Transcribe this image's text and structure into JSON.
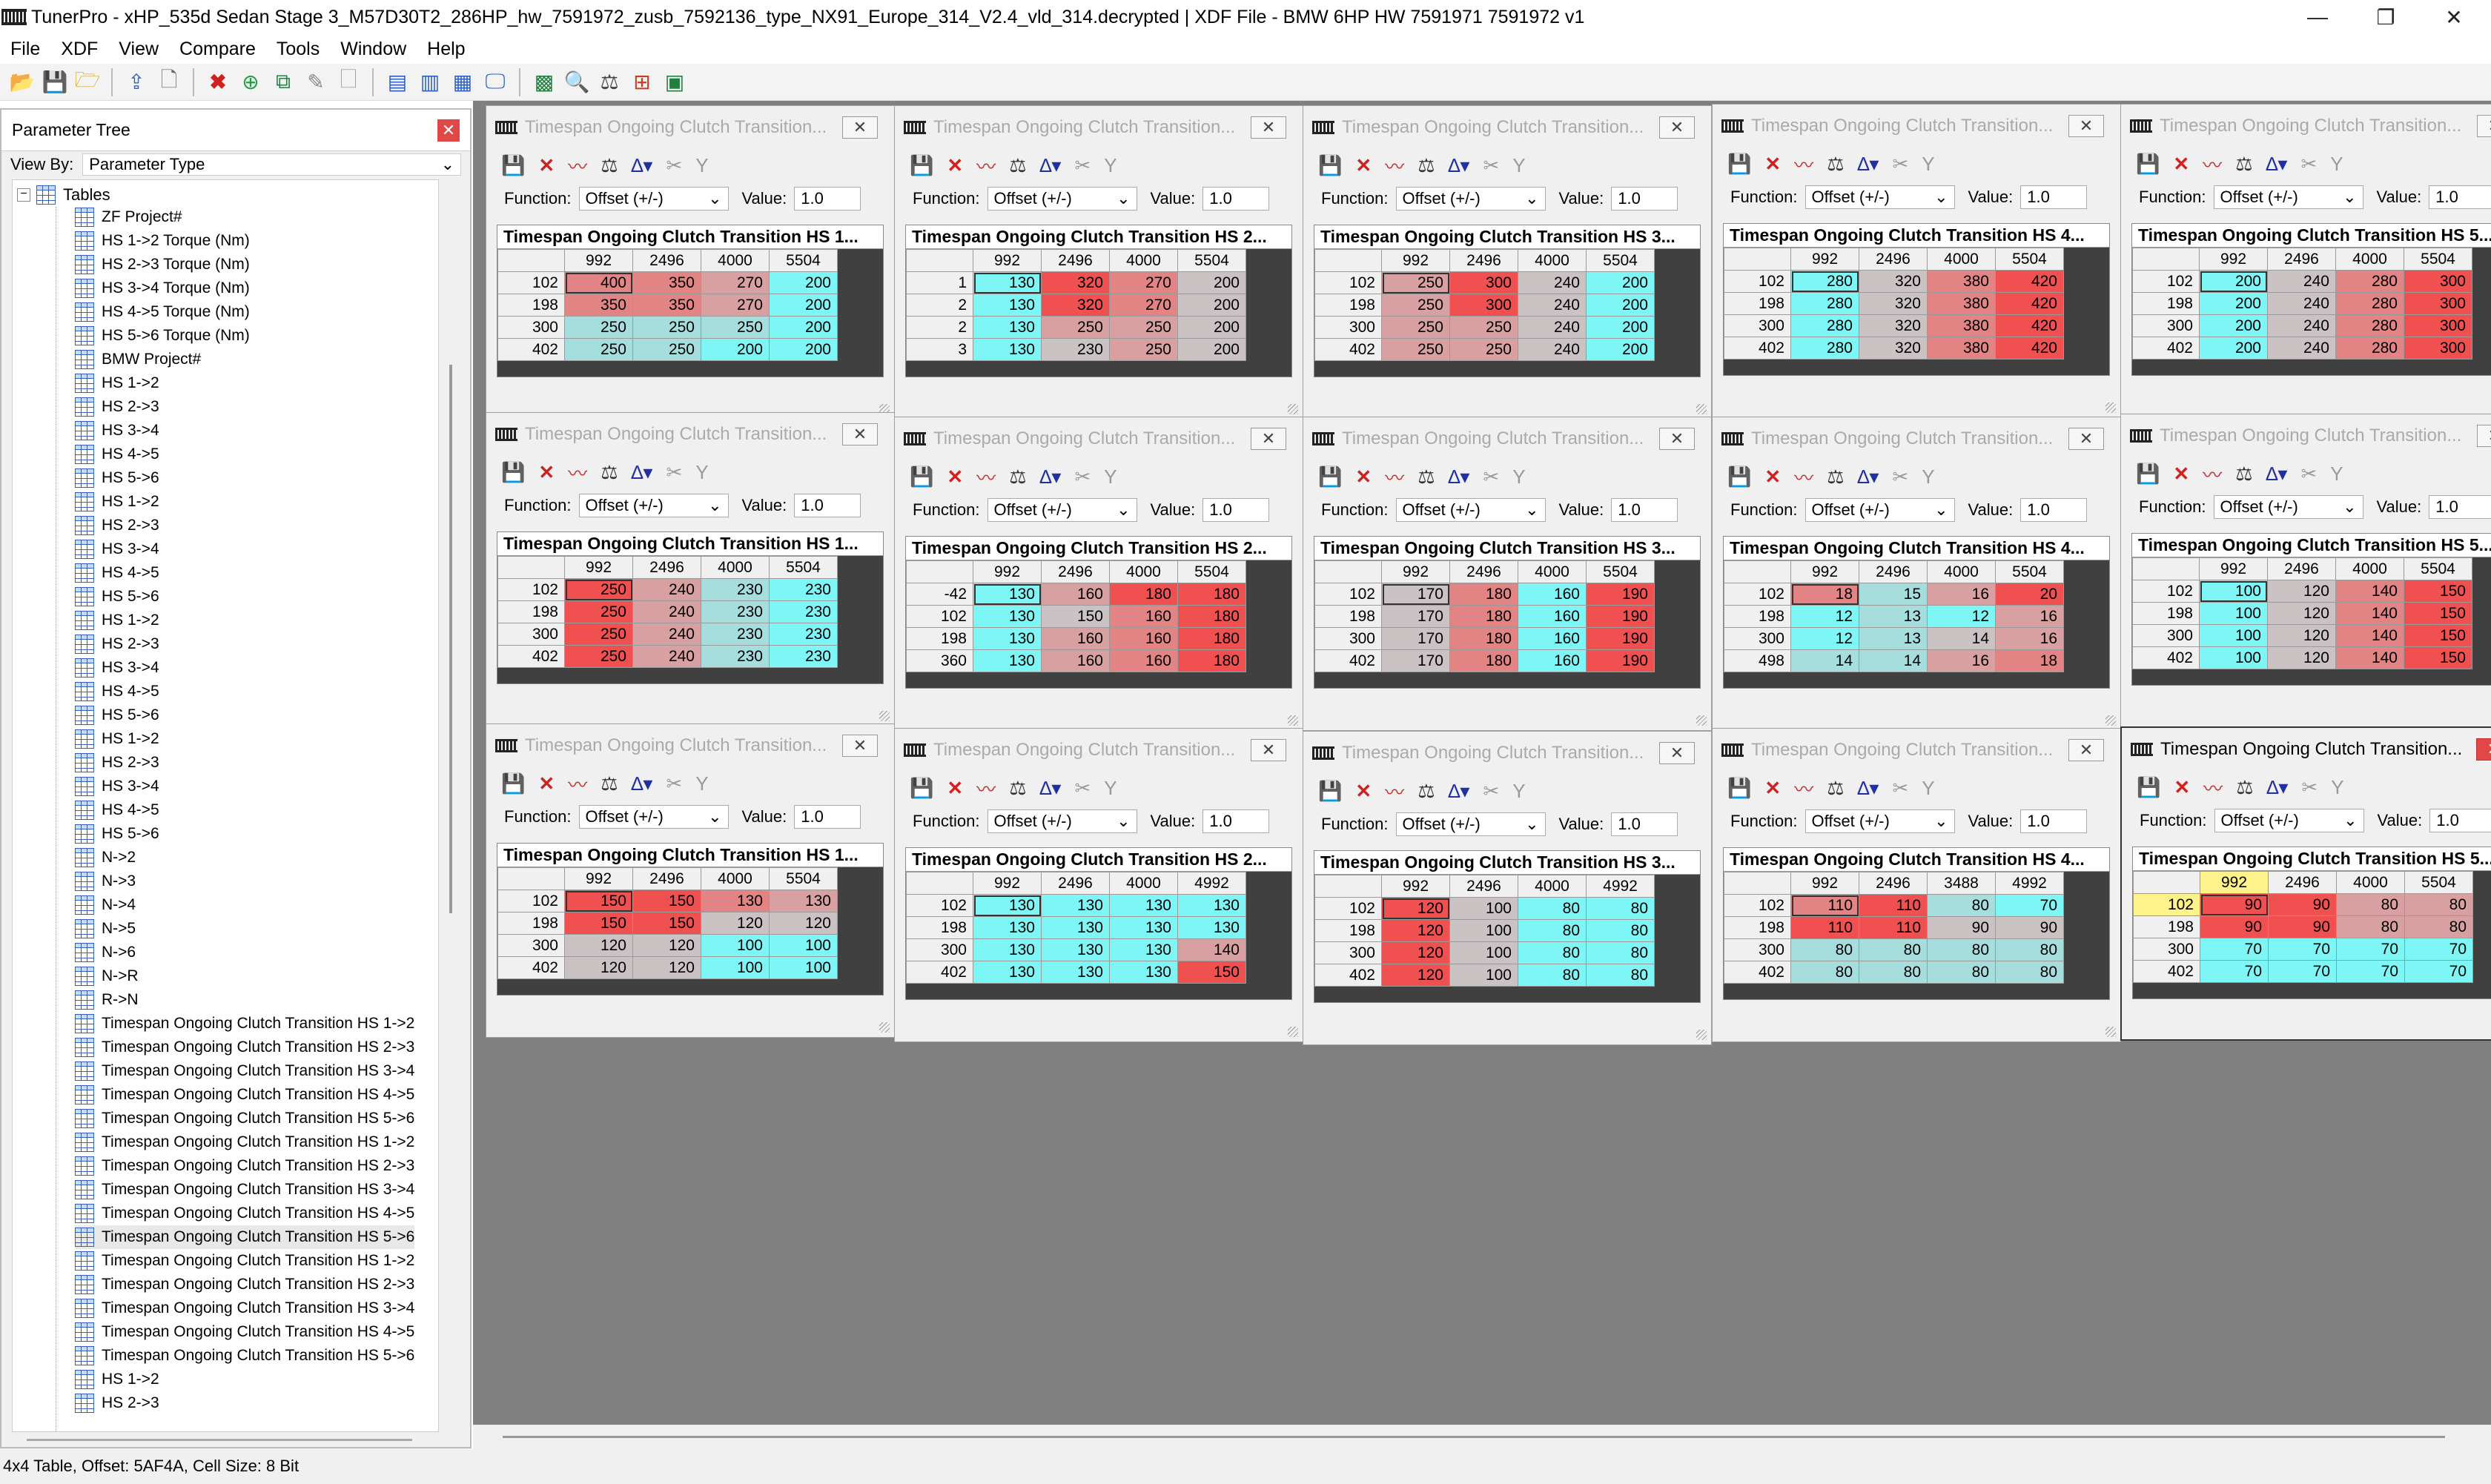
{
  "window": {
    "title": "TunerPro - xHP_535d Sedan Stage 3_M57D30T2_286HP_hw_7591972_zusb_7592136_type_NX91_Europe_314_V2.4_vld_314.decrypted | XDF File - BMW 6HP HW 7591971 7591972 v1",
    "controls": [
      "—",
      "❐",
      "✕"
    ]
  },
  "menu": [
    "File",
    "XDF",
    "View",
    "Compare",
    "Tools",
    "Window",
    "Help"
  ],
  "toolbar_icons": [
    "open-folder-icon",
    "save-icon",
    "open-file-icon",
    "import-icon",
    "new-document-icon",
    "close-red-x-icon",
    "add-green-icon",
    "copy-icon",
    "tools-icon",
    "blank-page-icon",
    "list-view-icon",
    "split-view-icon",
    "calendar-icon",
    "monitor-icon",
    "chart-icon",
    "magnify-icon",
    "compare-icon",
    "network-icon",
    "calculator-icon"
  ],
  "sidebar": {
    "title": "Parameter Tree",
    "view_by_label": "View By:",
    "view_by_value": "Parameter Type",
    "root": "Tables",
    "items": [
      "ZF Project#",
      "HS 1->2 Torque (Nm)",
      "HS 2->3 Torque (Nm)",
      "HS 3->4 Torque (Nm)",
      "HS 4->5 Torque (Nm)",
      "HS 5->6 Torque (Nm)",
      "BMW Project#",
      "HS 1->2",
      "HS 2->3",
      "HS 3->4",
      "HS 4->5",
      "HS 5->6",
      "HS 1->2",
      "HS 2->3",
      "HS 3->4",
      "HS 4->5",
      "HS 5->6",
      "HS 1->2",
      "HS 2->3",
      "HS 3->4",
      "HS 4->5",
      "HS 5->6",
      "HS 1->2",
      "HS 2->3",
      "HS 3->4",
      "HS 4->5",
      "HS 5->6",
      "N->2",
      "N->3",
      "N->4",
      "N->5",
      "N->6",
      "N->R",
      "R->N",
      "Timespan Ongoing Clutch Transition HS 1->2",
      "Timespan Ongoing Clutch Transition HS 2->3",
      "Timespan Ongoing Clutch Transition HS 3->4",
      "Timespan Ongoing Clutch Transition HS 4->5",
      "Timespan Ongoing Clutch Transition HS 5->6",
      "Timespan Ongoing Clutch Transition HS 1->2",
      "Timespan Ongoing Clutch Transition HS 2->3",
      "Timespan Ongoing Clutch Transition HS 3->4",
      "Timespan Ongoing Clutch Transition HS 4->5",
      "Timespan Ongoing Clutch Transition HS 5->6",
      "Timespan Ongoing Clutch Transition HS 1->2",
      "Timespan Ongoing Clutch Transition HS 2->3",
      "Timespan Ongoing Clutch Transition HS 3->4",
      "Timespan Ongoing Clutch Transition HS 4->5",
      "Timespan Ongoing Clutch Transition HS 5->6",
      "HS 1->2",
      "HS 2->3"
    ],
    "selected_index": 43
  },
  "status": "4x4 Table, Offset: 5AF4A,  Cell Size: 8 Bit",
  "color_map": {
    "t": "teal",
    "l": "light-teal",
    "g": "gray",
    "p": "pink",
    "s": "salmon",
    "r": "red"
  },
  "table_window": {
    "title_text": "Timespan Ongoing Clutch Transition...",
    "function_label": "Function:",
    "function_value": "Offset (+/-)",
    "value_label": "Value:",
    "value_value": "1.0"
  },
  "tables": [
    {
      "header": "Timespan Ongoing Clutch Transition HS 1...",
      "cols": [
        "992",
        "2496",
        "4000",
        "5504"
      ],
      "rows": [
        "102",
        "198",
        "300",
        "402"
      ],
      "values": [
        [
          "400",
          "350",
          "270",
          "200"
        ],
        [
          "350",
          "350",
          "270",
          "200"
        ],
        [
          "250",
          "250",
          "250",
          "200"
        ],
        [
          "250",
          "250",
          "200",
          "200"
        ]
      ],
      "colors": [
        [
          "s",
          "s",
          "p",
          "t"
        ],
        [
          "s",
          "s",
          "p",
          "t"
        ],
        [
          "l",
          "l",
          "l",
          "t"
        ],
        [
          "l",
          "l",
          "t",
          "t"
        ]
      ]
    },
    {
      "header": "Timespan Ongoing Clutch Transition HS 2...",
      "cols": [
        "992",
        "2496",
        "4000",
        "5504"
      ],
      "rows": [
        "1",
        "2",
        "2",
        "3"
      ],
      "values": [
        [
          "130",
          "320",
          "270",
          "200"
        ],
        [
          "130",
          "320",
          "270",
          "200"
        ],
        [
          "130",
          "250",
          "250",
          "200"
        ],
        [
          "130",
          "230",
          "250",
          "200"
        ]
      ],
      "colors": [
        [
          "t",
          "r",
          "s",
          "g"
        ],
        [
          "t",
          "r",
          "s",
          "g"
        ],
        [
          "t",
          "p",
          "p",
          "g"
        ],
        [
          "t",
          "g",
          "p",
          "g"
        ]
      ]
    },
    {
      "header": "Timespan Ongoing Clutch Transition HS 3...",
      "cols": [
        "992",
        "2496",
        "4000",
        "5504"
      ],
      "rows": [
        "102",
        "198",
        "300",
        "402"
      ],
      "values": [
        [
          "250",
          "300",
          "240",
          "200"
        ],
        [
          "250",
          "300",
          "240",
          "200"
        ],
        [
          "250",
          "250",
          "240",
          "200"
        ],
        [
          "250",
          "250",
          "240",
          "200"
        ]
      ],
      "colors": [
        [
          "p",
          "r",
          "g",
          "t"
        ],
        [
          "p",
          "r",
          "g",
          "t"
        ],
        [
          "p",
          "p",
          "g",
          "t"
        ],
        [
          "p",
          "p",
          "g",
          "t"
        ]
      ]
    },
    {
      "header": "Timespan Ongoing Clutch Transition HS 4...",
      "cols": [
        "992",
        "2496",
        "4000",
        "5504"
      ],
      "rows": [
        "102",
        "198",
        "300",
        "402"
      ],
      "values": [
        [
          "280",
          "320",
          "380",
          "420"
        ],
        [
          "280",
          "320",
          "380",
          "420"
        ],
        [
          "280",
          "320",
          "380",
          "420"
        ],
        [
          "280",
          "320",
          "380",
          "420"
        ]
      ],
      "colors": [
        [
          "t",
          "g",
          "s",
          "r"
        ],
        [
          "t",
          "g",
          "s",
          "r"
        ],
        [
          "t",
          "g",
          "s",
          "r"
        ],
        [
          "t",
          "g",
          "s",
          "r"
        ]
      ]
    },
    {
      "header": "Timespan Ongoing Clutch Transition HS 5...",
      "cols": [
        "992",
        "2496",
        "4000",
        "5504"
      ],
      "rows": [
        "102",
        "198",
        "300",
        "402"
      ],
      "values": [
        [
          "200",
          "240",
          "280",
          "300"
        ],
        [
          "200",
          "240",
          "280",
          "300"
        ],
        [
          "200",
          "240",
          "280",
          "300"
        ],
        [
          "200",
          "240",
          "280",
          "300"
        ]
      ],
      "colors": [
        [
          "t",
          "g",
          "s",
          "r"
        ],
        [
          "t",
          "g",
          "s",
          "r"
        ],
        [
          "t",
          "g",
          "s",
          "r"
        ],
        [
          "t",
          "g",
          "s",
          "r"
        ]
      ]
    },
    {
      "header": "Timespan Ongoing Clutch Transition HS 1...",
      "cols": [
        "992",
        "2496",
        "4000",
        "5504"
      ],
      "rows": [
        "102",
        "198",
        "300",
        "402"
      ],
      "values": [
        [
          "250",
          "240",
          "230",
          "230"
        ],
        [
          "250",
          "240",
          "230",
          "230"
        ],
        [
          "250",
          "240",
          "230",
          "230"
        ],
        [
          "250",
          "240",
          "230",
          "230"
        ]
      ],
      "colors": [
        [
          "r",
          "p",
          "l",
          "t"
        ],
        [
          "r",
          "p",
          "l",
          "t"
        ],
        [
          "r",
          "p",
          "l",
          "t"
        ],
        [
          "r",
          "p",
          "l",
          "t"
        ]
      ]
    },
    {
      "header": "Timespan Ongoing Clutch Transition HS 2...",
      "cols": [
        "992",
        "2496",
        "4000",
        "5504"
      ],
      "rows": [
        "-42",
        "102",
        "198",
        "360"
      ],
      "values": [
        [
          "130",
          "160",
          "180",
          "180"
        ],
        [
          "130",
          "150",
          "160",
          "180"
        ],
        [
          "130",
          "160",
          "160",
          "180"
        ],
        [
          "130",
          "160",
          "160",
          "180"
        ]
      ],
      "colors": [
        [
          "t",
          "p",
          "r",
          "r"
        ],
        [
          "t",
          "g",
          "s",
          "r"
        ],
        [
          "t",
          "p",
          "s",
          "r"
        ],
        [
          "t",
          "p",
          "s",
          "r"
        ]
      ]
    },
    {
      "header": "Timespan Ongoing Clutch Transition HS 3...",
      "cols": [
        "992",
        "2496",
        "4000",
        "5504"
      ],
      "rows": [
        "102",
        "198",
        "300",
        "402"
      ],
      "values": [
        [
          "170",
          "180",
          "160",
          "190"
        ],
        [
          "170",
          "180",
          "160",
          "190"
        ],
        [
          "170",
          "180",
          "160",
          "190"
        ],
        [
          "170",
          "180",
          "160",
          "190"
        ]
      ],
      "colors": [
        [
          "g",
          "s",
          "t",
          "r"
        ],
        [
          "g",
          "s",
          "t",
          "r"
        ],
        [
          "g",
          "s",
          "t",
          "r"
        ],
        [
          "g",
          "s",
          "t",
          "r"
        ]
      ]
    },
    {
      "header": "Timespan Ongoing Clutch Transition HS 4...",
      "cols": [
        "992",
        "2496",
        "4000",
        "5504"
      ],
      "rows": [
        "102",
        "198",
        "300",
        "498"
      ],
      "values": [
        [
          "18",
          "15",
          "16",
          "20"
        ],
        [
          "12",
          "13",
          "12",
          "16"
        ],
        [
          "12",
          "13",
          "14",
          "16"
        ],
        [
          "14",
          "14",
          "16",
          "18"
        ]
      ],
      "colors": [
        [
          "s",
          "l",
          "p",
          "r"
        ],
        [
          "t",
          "l",
          "t",
          "p"
        ],
        [
          "t",
          "l",
          "g",
          "p"
        ],
        [
          "l",
          "l",
          "p",
          "s"
        ]
      ]
    },
    {
      "header": "Timespan Ongoing Clutch Transition HS 5...",
      "cols": [
        "992",
        "2496",
        "4000",
        "5504"
      ],
      "rows": [
        "102",
        "198",
        "300",
        "402"
      ],
      "values": [
        [
          "100",
          "120",
          "140",
          "150"
        ],
        [
          "100",
          "120",
          "140",
          "150"
        ],
        [
          "100",
          "120",
          "140",
          "150"
        ],
        [
          "100",
          "120",
          "140",
          "150"
        ]
      ],
      "colors": [
        [
          "t",
          "g",
          "s",
          "r"
        ],
        [
          "t",
          "g",
          "s",
          "r"
        ],
        [
          "t",
          "g",
          "s",
          "r"
        ],
        [
          "t",
          "g",
          "s",
          "r"
        ]
      ]
    },
    {
      "header": "Timespan Ongoing Clutch Transition HS 1...",
      "cols": [
        "992",
        "2496",
        "4000",
        "5504"
      ],
      "rows": [
        "102",
        "198",
        "300",
        "402"
      ],
      "values": [
        [
          "150",
          "150",
          "130",
          "130"
        ],
        [
          "150",
          "150",
          "120",
          "120"
        ],
        [
          "120",
          "120",
          "100",
          "100"
        ],
        [
          "120",
          "120",
          "100",
          "100"
        ]
      ],
      "colors": [
        [
          "r",
          "r",
          "s",
          "p"
        ],
        [
          "r",
          "r",
          "g",
          "g"
        ],
        [
          "g",
          "g",
          "t",
          "t"
        ],
        [
          "g",
          "g",
          "t",
          "t"
        ]
      ]
    },
    {
      "header": "Timespan Ongoing Clutch Transition HS 2...",
      "cols": [
        "992",
        "2496",
        "4000",
        "4992"
      ],
      "rows": [
        "102",
        "198",
        "300",
        "402"
      ],
      "values": [
        [
          "130",
          "130",
          "130",
          "130"
        ],
        [
          "130",
          "130",
          "130",
          "130"
        ],
        [
          "130",
          "130",
          "130",
          "140"
        ],
        [
          "130",
          "130",
          "130",
          "150"
        ]
      ],
      "colors": [
        [
          "t",
          "t",
          "t",
          "t"
        ],
        [
          "t",
          "t",
          "t",
          "t"
        ],
        [
          "t",
          "t",
          "t",
          "p"
        ],
        [
          "t",
          "t",
          "t",
          "r"
        ]
      ]
    },
    {
      "header": "Timespan Ongoing Clutch Transition HS 3...",
      "cols": [
        "992",
        "2496",
        "4000",
        "4992"
      ],
      "rows": [
        "102",
        "198",
        "300",
        "402"
      ],
      "values": [
        [
          "120",
          "100",
          "80",
          "80"
        ],
        [
          "120",
          "100",
          "80",
          "80"
        ],
        [
          "120",
          "100",
          "80",
          "80"
        ],
        [
          "120",
          "100",
          "80",
          "80"
        ]
      ],
      "colors": [
        [
          "r",
          "g",
          "t",
          "t"
        ],
        [
          "r",
          "g",
          "t",
          "t"
        ],
        [
          "r",
          "g",
          "t",
          "t"
        ],
        [
          "r",
          "g",
          "t",
          "t"
        ]
      ]
    },
    {
      "header": "Timespan Ongoing Clutch Transition HS 4...",
      "cols": [
        "992",
        "2496",
        "3488",
        "4992"
      ],
      "rows": [
        "102",
        "198",
        "300",
        "402"
      ],
      "values": [
        [
          "110",
          "110",
          "80",
          "70"
        ],
        [
          "110",
          "110",
          "90",
          "90"
        ],
        [
          "80",
          "80",
          "80",
          "80"
        ],
        [
          "80",
          "80",
          "80",
          "80"
        ]
      ],
      "colors": [
        [
          "s",
          "r",
          "l",
          "t"
        ],
        [
          "r",
          "r",
          "g",
          "g"
        ],
        [
          "l",
          "l",
          "l",
          "l"
        ],
        [
          "l",
          "l",
          "l",
          "l"
        ]
      ]
    },
    {
      "header": "Timespan Ongoing Clutch Transition HS 5...",
      "cols": [
        "992",
        "2496",
        "4000",
        "5504"
      ],
      "rows": [
        "102",
        "198",
        "300",
        "402"
      ],
      "values": [
        [
          "90",
          "90",
          "80",
          "80"
        ],
        [
          "90",
          "90",
          "80",
          "80"
        ],
        [
          "70",
          "70",
          "70",
          "70"
        ],
        [
          "70",
          "70",
          "70",
          "70"
        ]
      ],
      "colors": [
        [
          "r",
          "r",
          "p",
          "p"
        ],
        [
          "r",
          "r",
          "p",
          "p"
        ],
        [
          "t",
          "t",
          "t",
          "t"
        ],
        [
          "t",
          "t",
          "t",
          "t"
        ]
      ]
    }
  ]
}
